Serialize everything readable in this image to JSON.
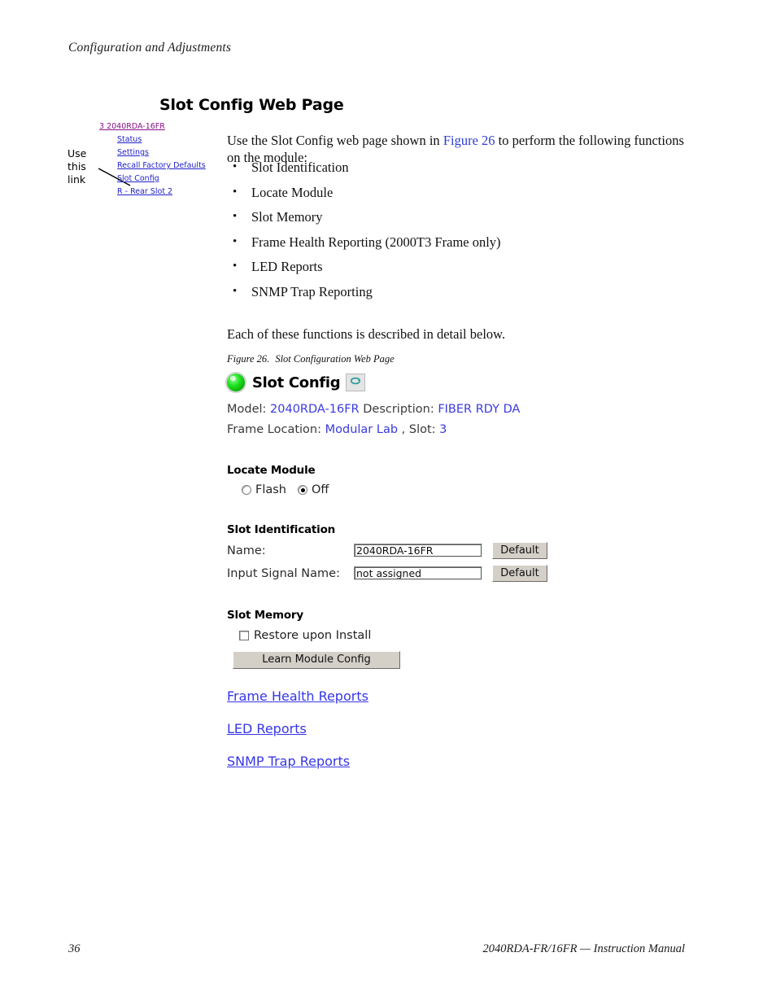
{
  "running_header": "Configuration and Adjustments",
  "section_title": "Slot Config Web Page",
  "callout": {
    "label": "Use this link",
    "nav_items": [
      {
        "label": "3 2040RDA-16FR",
        "state": "visited"
      },
      {
        "label": "Status",
        "state": "link"
      },
      {
        "label": "Settings",
        "state": "link"
      },
      {
        "label": "Recall Factory Defaults",
        "state": "link"
      },
      {
        "label": "Slot Config",
        "state": "link"
      },
      {
        "label": "R - Rear Slot 2",
        "state": "link"
      }
    ]
  },
  "body": {
    "intro_before": "Use the Slot Config web page shown in ",
    "intro_xref": "Figure 26",
    "intro_after": " to perform the following functions on the module:",
    "bullets": [
      "Slot Identification",
      "Locate Module",
      "Slot Memory",
      "Frame Health Reporting (2000T3 Frame only)",
      "LED Reports",
      "SNMP Trap Reporting"
    ],
    "closing": "Each of these functions is described in detail below."
  },
  "figure": {
    "caption_number": "Figure 26.",
    "caption_text": "Slot Configuration Web Page",
    "status_led_color": "#21e321",
    "refresh_icon_color": "#2e9b9b",
    "page_title": "Slot Config",
    "meta": {
      "model_label": "Model:",
      "model_value": "2040RDA-16FR",
      "description_label": "Description:",
      "description_value": "FIBER RDY DA",
      "frame_location_label": "Frame Location:",
      "frame_location_value": "Modular Lab",
      "slot_separator": ",",
      "slot_label": "Slot:",
      "slot_value": "3"
    },
    "locate_module": {
      "heading": "Locate Module",
      "options": [
        {
          "label": "Flash",
          "selected": false
        },
        {
          "label": "Off",
          "selected": true
        }
      ]
    },
    "slot_identification": {
      "heading": "Slot Identification",
      "rows": [
        {
          "label": "Name:",
          "value": "2040RDA-16FR",
          "button": "Default"
        },
        {
          "label": "Input Signal Name:",
          "value": "not assigned",
          "button": "Default"
        }
      ]
    },
    "slot_memory": {
      "heading": "Slot Memory",
      "checkbox_label": "Restore upon Install",
      "checkbox_checked": false,
      "button": "Learn Module Config"
    },
    "report_links": [
      "Frame Health Reports",
      "LED Reports",
      "SNMP Trap Reports"
    ]
  },
  "footer": {
    "page_number": "36",
    "manual_title": "2040RDA-FR/16FR — Instruction Manual"
  },
  "colors": {
    "link_blue": "#2222cc",
    "link_visited_purple": "#881188",
    "value_blue": "#3a3ae0",
    "xref_blue": "#2f3fcf",
    "button_face": "#d4d0c8"
  }
}
